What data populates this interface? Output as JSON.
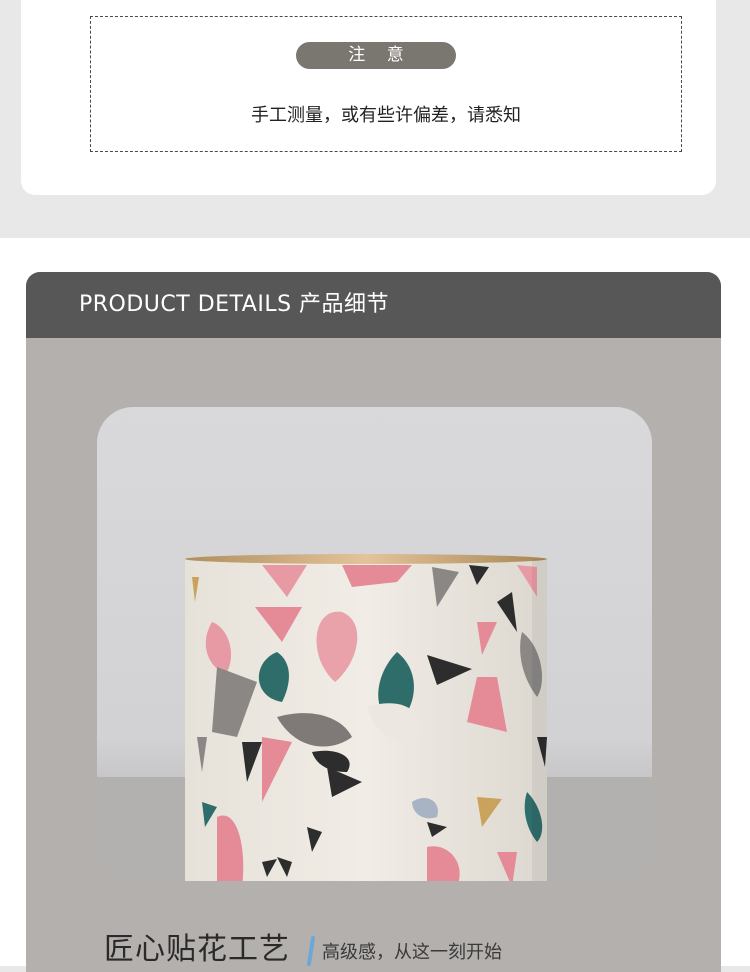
{
  "notice": {
    "label": "注 意",
    "text": "手工测量，或有些许偏差，请悉知"
  },
  "details": {
    "header": "PRODUCT DETAILS 产品细节",
    "image_description_icon": "terrazzo-mug-photo",
    "caption_title": "匠心贴花工艺",
    "caption_subtitle": "高级感，从这一刻开始"
  },
  "colors": {
    "page_bg": "#e8e8e8",
    "header_bg": "#575757",
    "card_bg": "#b4b0ad",
    "pill_bg": "#7a7670",
    "accent_slash": "#6aa9d6"
  }
}
